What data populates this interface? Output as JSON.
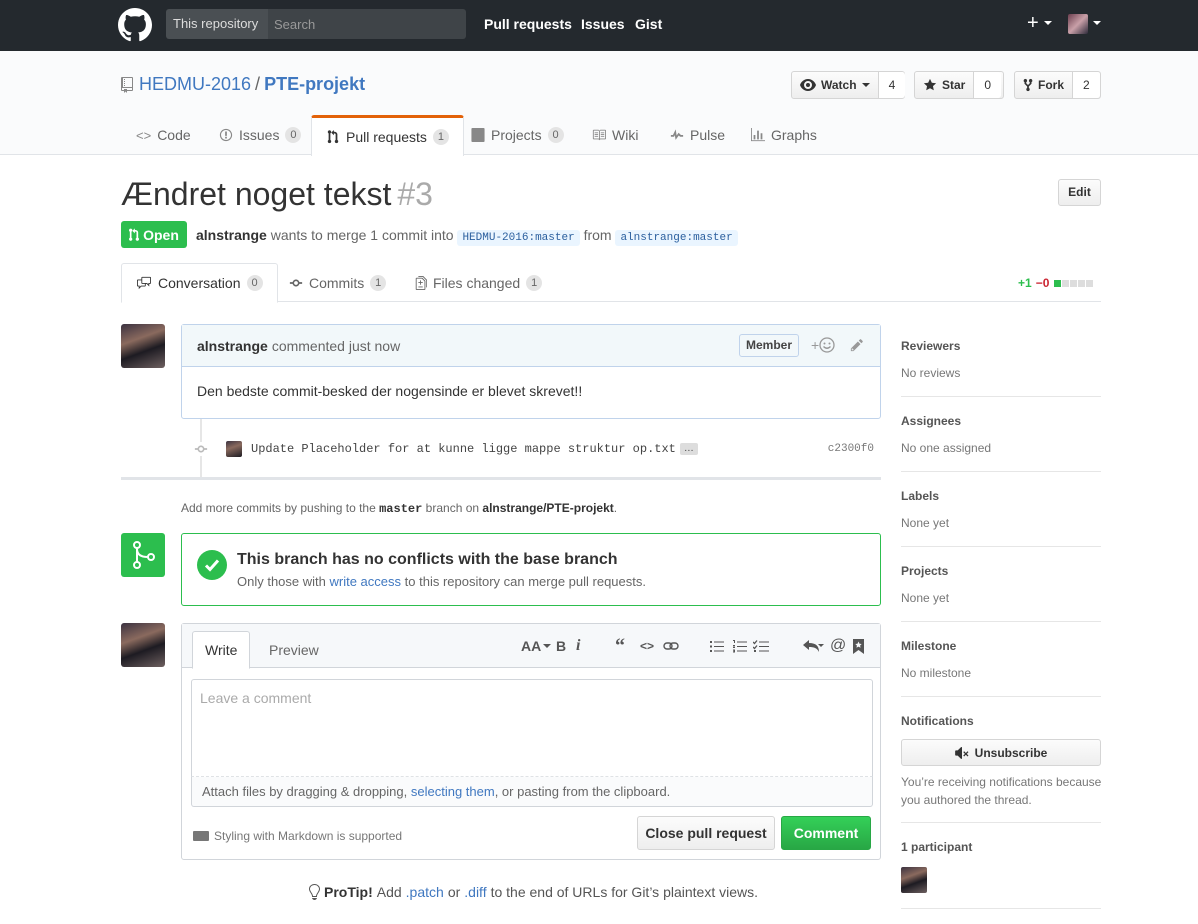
{
  "header": {
    "scope_label": "This repository",
    "search_placeholder": "Search",
    "nav": [
      "Pull requests",
      "Issues",
      "Gist"
    ]
  },
  "repo": {
    "owner": "HEDMU-2016",
    "name": "PTE-projekt",
    "watch": {
      "label": "Watch",
      "count": "4"
    },
    "star": {
      "label": "Star",
      "count": "0"
    },
    "fork": {
      "label": "Fork",
      "count": "2"
    },
    "tabs": [
      {
        "label": "Code",
        "count": ""
      },
      {
        "label": "Issues",
        "count": "0"
      },
      {
        "label": "Pull requests",
        "count": "1"
      },
      {
        "label": "Projects",
        "count": "0"
      },
      {
        "label": "Wiki",
        "count": ""
      },
      {
        "label": "Pulse",
        "count": ""
      },
      {
        "label": "Graphs",
        "count": ""
      }
    ]
  },
  "pr": {
    "title": "Ændret noget tekst",
    "number": "#3",
    "edit_label": "Edit",
    "state": "Open",
    "author": "alnstrange",
    "meta_text": "wants to merge 1 commit into",
    "base_ref": "HEDMU-2016:master",
    "from_text": "from",
    "head_ref": "alnstrange:master",
    "tabs": [
      {
        "label": "Conversation",
        "count": "0"
      },
      {
        "label": "Commits",
        "count": "1"
      },
      {
        "label": "Files changed",
        "count": "1"
      }
    ],
    "diffstat": {
      "additions": "+1",
      "deletions": "−0"
    }
  },
  "comment": {
    "author": "alnstrange",
    "action": "commented just now",
    "badge": "Member",
    "body": "Den bedste commit-besked der nogensinde er blevet skrevet!!"
  },
  "commit": {
    "message": "Update Placeholder for at kunne ligge mappe struktur op.txt",
    "ellipsis": "…",
    "sha": "c2300f0"
  },
  "push_note": {
    "prefix": "Add more commits by pushing to the",
    "branch": "master",
    "middle": "branch on",
    "repo": "alnstrange/PTE-projekt",
    "suffix": "."
  },
  "merge": {
    "title": "This branch has no conflicts with the base branch",
    "sub_prefix": "Only those with",
    "sub_link": "write access",
    "sub_suffix": "to this repository can merge pull requests."
  },
  "form": {
    "tab_write": "Write",
    "tab_preview": "Preview",
    "placeholder": "Leave a comment",
    "attach_prefix": "Attach files by dragging & dropping,",
    "attach_link": "selecting them",
    "attach_suffix": ", or pasting from the clipboard.",
    "markdown_note": "Styling with Markdown is supported",
    "close_label": "Close pull request",
    "comment_label": "Comment"
  },
  "protip": {
    "label": "ProTip!",
    "text1": "Add",
    "link1": ".patch",
    "text2": "or",
    "link2": ".diff",
    "text3": "to the end of URLs for Git’s plaintext views."
  },
  "sidebar": {
    "reviewers": {
      "title": "Reviewers",
      "value": "No reviews"
    },
    "assignees": {
      "title": "Assignees",
      "value": "No one assigned"
    },
    "labels": {
      "title": "Labels",
      "value": "None yet"
    },
    "projects": {
      "title": "Projects",
      "value": "None yet"
    },
    "milestone": {
      "title": "Milestone",
      "value": "No milestone"
    },
    "notifications": {
      "title": "Notifications",
      "button": "Unsubscribe",
      "text": "You’re receiving notifications because you authored the thread."
    },
    "participants": "1 participant"
  },
  "colors": {
    "accent": "#4078c0",
    "open_green": "#2cbe4e",
    "header_bg": "#24292e",
    "tab_active": "#e36209"
  }
}
